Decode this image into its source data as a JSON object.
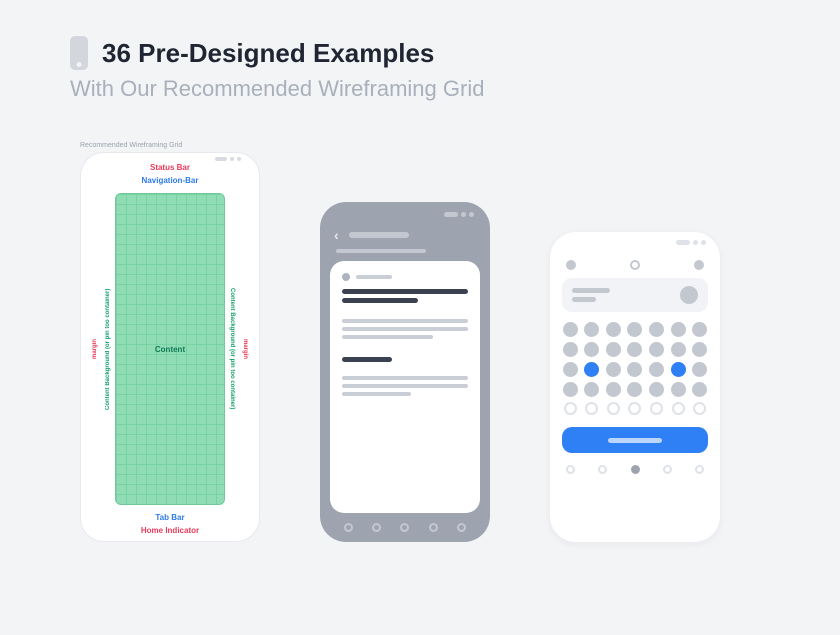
{
  "header": {
    "title": "36 Pre-Designed Examples",
    "subtitle": "With Our Recommended Wireframing Grid"
  },
  "phone1": {
    "caption": "Recommended Wireframing Grid",
    "status_bar": "Status Bar",
    "navigation_bar": "Navigation-Bar",
    "margin_left": "margin",
    "content_bg_left": "Content Background (or pin too container)",
    "content": "Content",
    "content_bg_right": "Content Background (or pin too container)",
    "margin_right": "margin",
    "tab_bar": "Tab Bar",
    "home_indicator": "Home Indicator"
  }
}
